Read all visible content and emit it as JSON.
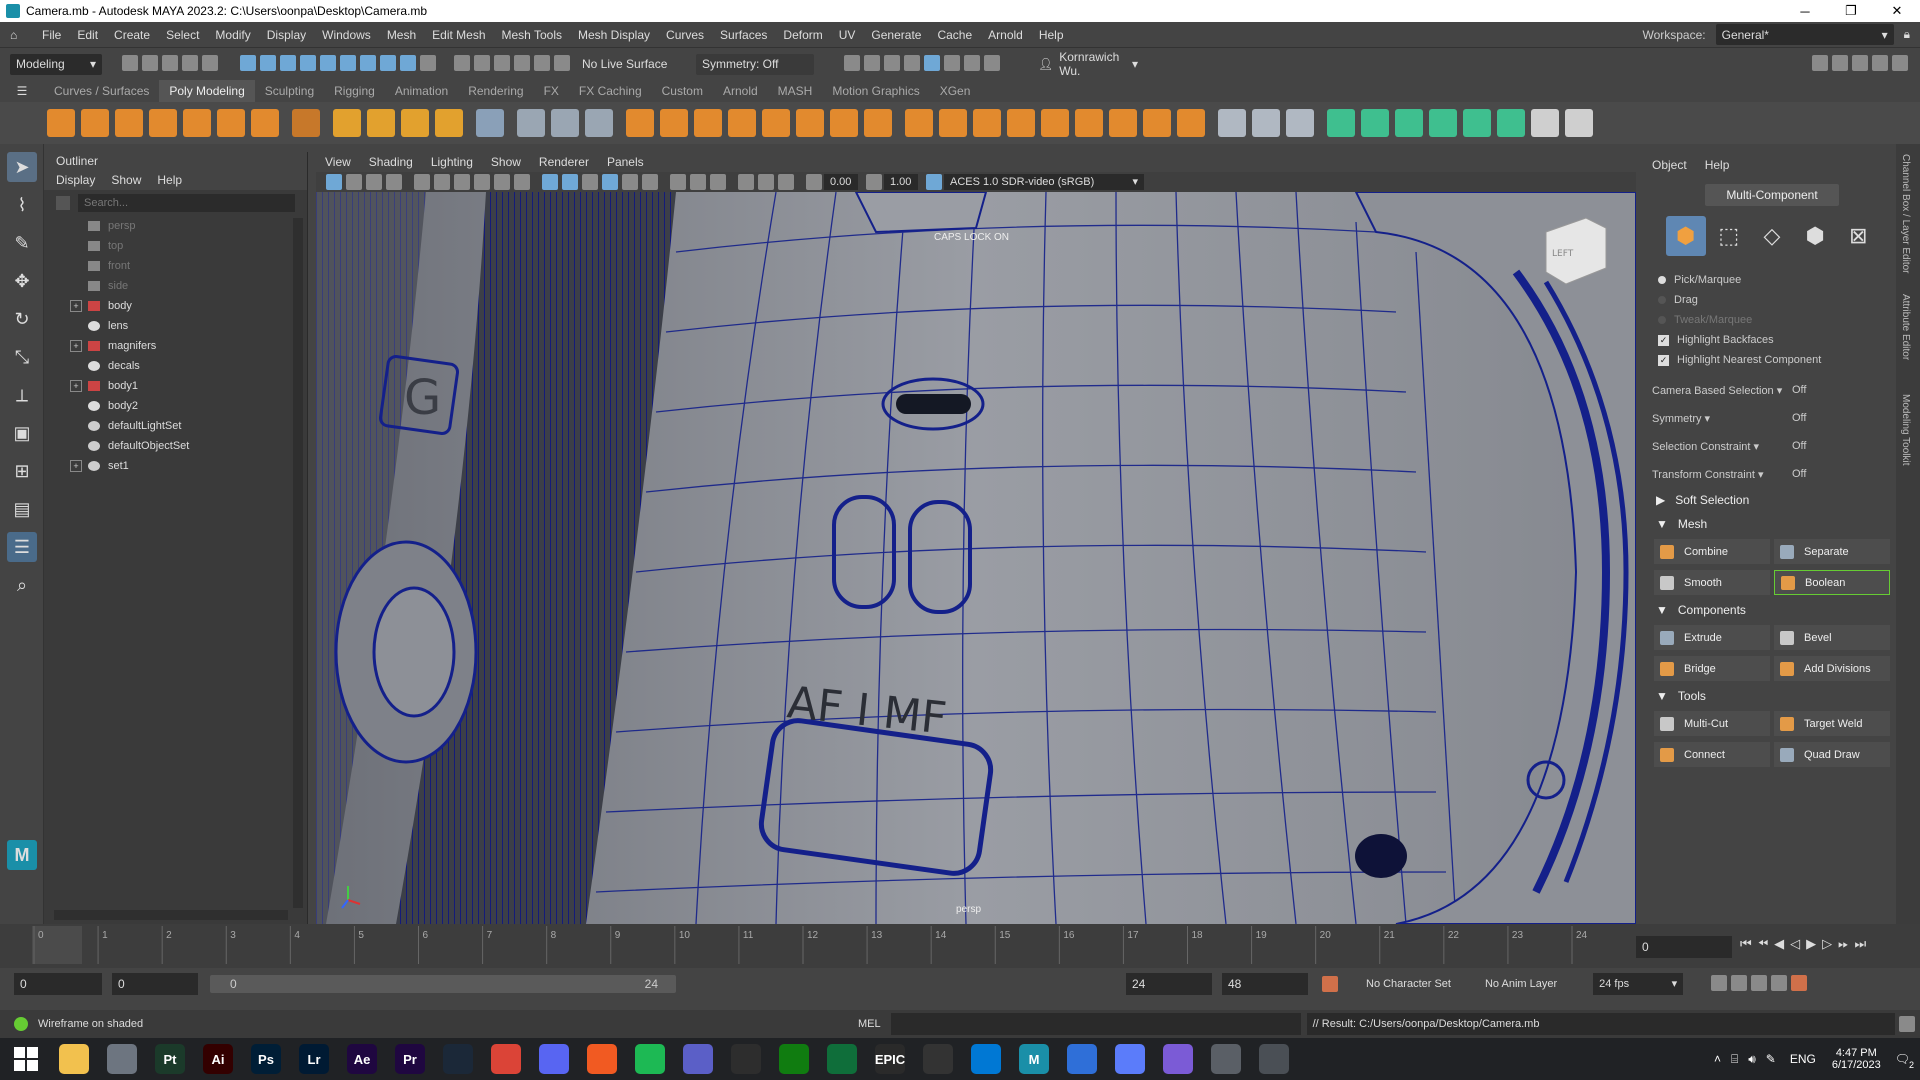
{
  "window": {
    "title": "Camera.mb - Autodesk MAYA 2023.2: C:\\Users\\oonpa\\Desktop\\Camera.mb",
    "min": "─",
    "max": "❐",
    "close": "✕"
  },
  "menu": [
    "File",
    "Edit",
    "Create",
    "Select",
    "Modify",
    "Display",
    "Windows",
    "Mesh",
    "Edit Mesh",
    "Mesh Tools",
    "Mesh Display",
    "Curves",
    "Surfaces",
    "Deform",
    "UV",
    "Generate",
    "Cache",
    "Arnold",
    "Help"
  ],
  "workspace": {
    "label": "Workspace:",
    "value": "General*"
  },
  "statusline": {
    "mode": "Modeling",
    "live_surface": "No Live Surface",
    "symmetry": "Symmetry: Off",
    "user": "Kornrawich Wu."
  },
  "shelf_tabs": [
    "Curves / Surfaces",
    "Poly Modeling",
    "Sculpting",
    "Rigging",
    "Animation",
    "Rendering",
    "FX",
    "FX Caching",
    "Custom",
    "Arnold",
    "MASH",
    "Motion Graphics",
    "XGen"
  ],
  "outliner": {
    "title": "Outliner",
    "menu": [
      "Display",
      "Show",
      "Help"
    ],
    "search_placeholder": "Search...",
    "items": [
      {
        "label": "persp",
        "dim": true,
        "expand": false,
        "icon": "camera-icon"
      },
      {
        "label": "top",
        "dim": true,
        "expand": false,
        "icon": "camera-icon"
      },
      {
        "label": "front",
        "dim": true,
        "expand": false,
        "icon": "camera-icon"
      },
      {
        "label": "side",
        "dim": true,
        "expand": false,
        "icon": "camera-icon"
      },
      {
        "label": "body",
        "dim": false,
        "expand": true,
        "icon": "group-icon"
      },
      {
        "label": "lens",
        "dim": false,
        "expand": false,
        "icon": "mesh-icon"
      },
      {
        "label": "magnifers",
        "dim": false,
        "expand": true,
        "icon": "group-icon"
      },
      {
        "label": "decals",
        "dim": false,
        "expand": false,
        "icon": "mesh-icon"
      },
      {
        "label": "body1",
        "dim": false,
        "expand": true,
        "icon": "group-icon"
      },
      {
        "label": "body2",
        "dim": false,
        "expand": false,
        "icon": "mesh-icon"
      },
      {
        "label": "defaultLightSet",
        "dim": false,
        "expand": false,
        "icon": "set-icon"
      },
      {
        "label": "defaultObjectSet",
        "dim": false,
        "expand": false,
        "icon": "set-icon"
      },
      {
        "label": "set1",
        "dim": false,
        "expand": true,
        "icon": "set-icon"
      }
    ]
  },
  "viewport": {
    "menu": [
      "View",
      "Shading",
      "Lighting",
      "Show",
      "Renderer",
      "Panels"
    ],
    "exposure": "0.00",
    "gamma": "1.00",
    "colorspace": "ACES 1.0 SDR-video (sRGB)",
    "caps_lock": "CAPS LOCK ON",
    "camera_label": "persp",
    "cube_label": "LEFT",
    "model_text": "AF  I  MF"
  },
  "modeling_toolkit": {
    "menu": [
      "Object",
      "Help"
    ],
    "multi_component": "Multi-Component",
    "radios": [
      "Pick/Marquee",
      "Drag",
      "Tweak/Marquee"
    ],
    "checks": [
      "Highlight Backfaces",
      "Highlight Nearest Component"
    ],
    "props": [
      {
        "label": "Camera Based Selection",
        "value": "Off"
      },
      {
        "label": "Symmetry",
        "value": "Off"
      },
      {
        "label": "Selection Constraint",
        "value": "Off"
      },
      {
        "label": "Transform Constraint",
        "value": "Off"
      }
    ],
    "soft_selection": "Soft Selection",
    "sections": [
      {
        "title": "Mesh",
        "buttons": [
          "Combine",
          "Separate",
          "Smooth",
          "Boolean"
        ]
      },
      {
        "title": "Components",
        "buttons": [
          "Extrude",
          "Bevel",
          "Bridge",
          "Add Divisions"
        ]
      },
      {
        "title": "Tools",
        "buttons": [
          "Multi-Cut",
          "Target Weld",
          "Connect",
          "Quad Draw"
        ]
      }
    ]
  },
  "side_tabs": [
    "Channel Box / Layer Editor",
    "Attribute Editor",
    "Modeling Toolkit"
  ],
  "timeline": {
    "ticks": [
      "0",
      "1",
      "2",
      "3",
      "4",
      "5",
      "6",
      "7",
      "8",
      "9",
      "10",
      "11",
      "12",
      "13",
      "14",
      "15",
      "16",
      "17",
      "18",
      "19",
      "20",
      "21",
      "22",
      "23",
      "24"
    ],
    "current_frame": "0"
  },
  "range": {
    "start": "0",
    "anim_start": "0",
    "slider_start": "0",
    "slider_end": "24",
    "end": "24",
    "anim_end": "48",
    "character_set": "No Character Set",
    "anim_layer": "No Anim Layer",
    "fps": "24 fps"
  },
  "command": {
    "help": "Wireframe on shaded",
    "lang": "MEL",
    "result": "// Result: C:/Users/oonpa/Desktop/Camera.mb"
  },
  "taskbar": {
    "apps": [
      {
        "name": "file-explorer-icon",
        "label": "",
        "color": "#f2c14e"
      },
      {
        "name": "app-icon",
        "label": "",
        "color": "#6d7580"
      },
      {
        "name": "painter-icon",
        "label": "Pt",
        "color": "#1b3a2a"
      },
      {
        "name": "illustrator-icon",
        "label": "Ai",
        "color": "#330000"
      },
      {
        "name": "photoshop-icon",
        "label": "Ps",
        "color": "#001e36"
      },
      {
        "name": "lightroom-icon",
        "label": "Lr",
        "color": "#001a33"
      },
      {
        "name": "aftereffects-icon",
        "label": "Ae",
        "color": "#1f0740"
      },
      {
        "name": "premiere-icon",
        "label": "Pr",
        "color": "#1f0740"
      },
      {
        "name": "steam-icon",
        "label": "",
        "color": "#1b2838"
      },
      {
        "name": "chrome-icon",
        "label": "",
        "color": "#db4437"
      },
      {
        "name": "discord-icon",
        "label": "",
        "color": "#5865f2"
      },
      {
        "name": "brave-icon",
        "label": "",
        "color": "#f15a22"
      },
      {
        "name": "spotify-icon",
        "label": "",
        "color": "#1db954"
      },
      {
        "name": "teams-icon",
        "label": "",
        "color": "#5b5fc7"
      },
      {
        "name": "app-ring-icon",
        "label": "",
        "color": "#2d2d2d"
      },
      {
        "name": "xbox-icon",
        "label": "",
        "color": "#107c10"
      },
      {
        "name": "app-green-icon",
        "label": "",
        "color": "#0f6e3a"
      },
      {
        "name": "epic-icon",
        "label": "EPIC",
        "color": "#2a2a2a"
      },
      {
        "name": "app-circle-icon",
        "label": "",
        "color": "#333"
      },
      {
        "name": "app-blue-icon",
        "label": "",
        "color": "#0078d4"
      },
      {
        "name": "maya-icon",
        "label": "M",
        "color": "#1a8fa8"
      },
      {
        "name": "app-cloud-icon",
        "label": "",
        "color": "#2f6fd8"
      },
      {
        "name": "app-triangle-icon",
        "label": "",
        "color": "#5b7cfa"
      },
      {
        "name": "app-orb-icon",
        "label": "",
        "color": "#7b5bd6"
      },
      {
        "name": "app-shield-icon",
        "label": "",
        "color": "#5a5f66"
      },
      {
        "name": "app-dark-icon",
        "label": "",
        "color": "#4a4f55"
      }
    ],
    "lang": "ENG",
    "time": "4:47 PM",
    "date": "6/17/2023",
    "notifications": "2"
  }
}
